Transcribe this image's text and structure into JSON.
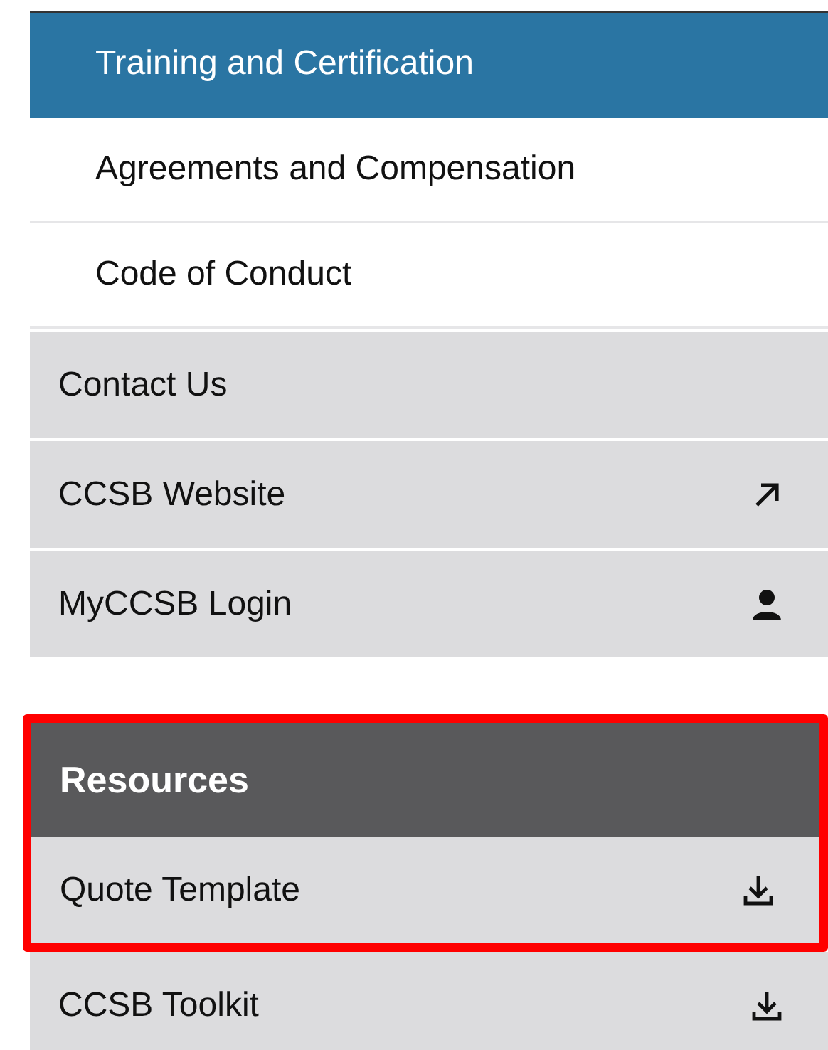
{
  "nav": {
    "subitems": [
      {
        "label": "Training and Certification",
        "selected": true
      },
      {
        "label": "Agreements and Compensation",
        "selected": false
      },
      {
        "label": "Code of Conduct",
        "selected": false
      }
    ],
    "items": [
      {
        "label": "Contact Us",
        "kind": "plain"
      },
      {
        "label": "CCSB Website",
        "kind": "external"
      },
      {
        "label": "MyCCSB Login",
        "kind": "account"
      }
    ]
  },
  "resources": {
    "title": "Resources",
    "highlighted": true,
    "items": [
      {
        "label": "Quote Template",
        "kind": "download",
        "highlighted": true
      },
      {
        "label": "CCSB Toolkit",
        "kind": "download",
        "highlighted": false
      }
    ]
  }
}
